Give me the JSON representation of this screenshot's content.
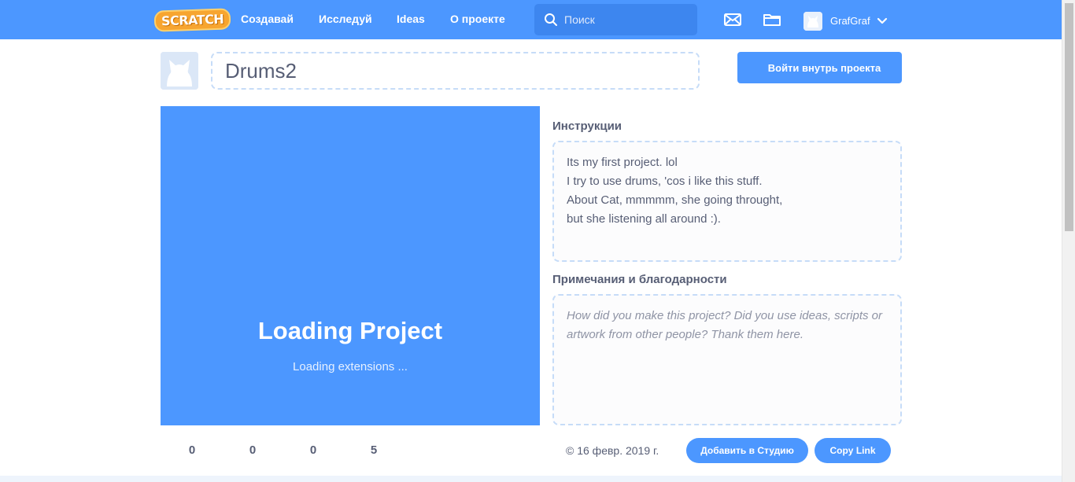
{
  "nav": {
    "logo_text": "SCRATCH",
    "links": [
      "Создавай",
      "Исследуй",
      "Ideas",
      "О проекте"
    ],
    "search_placeholder": "Поиск",
    "username": "GrafGraf"
  },
  "project": {
    "title": "Drums2",
    "see_inside_label": "Войти внутрь проекта",
    "loading_title": "Loading Project",
    "loading_sub": "Loading extensions ..."
  },
  "stats": [
    "0",
    "0",
    "0",
    "5"
  ],
  "instructions": {
    "label": "Инструкции",
    "lines": [
      "Its my first project. lol",
      "I try to use drums, 'cos i like this stuff.",
      "About  Cat, mmmmm, she going throught,",
      "but she listening all around :)."
    ]
  },
  "notes": {
    "label": "Примечания и благодарности",
    "placeholder": "How did you make this project? Did you use ideas, scripts or artwork from other people? Thank them here."
  },
  "footer": {
    "date": "16 февр. 2019 г.",
    "add_to_studio": "Добавить в Студию",
    "copy_link": "Copy Link"
  },
  "colors": {
    "brand_blue": "#4c97ff",
    "text": "#575e75",
    "dashed_border": "#c6dcf8"
  }
}
